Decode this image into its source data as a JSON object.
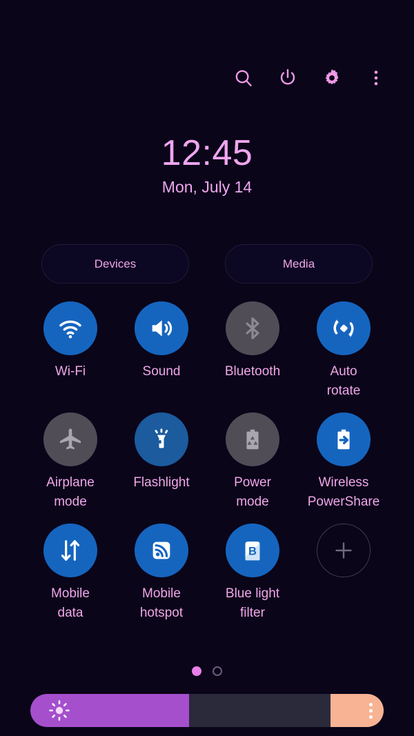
{
  "statusbar": {
    "actions": [
      {
        "name": "search-icon",
        "label": "Search"
      },
      {
        "name": "power-icon",
        "label": "Power off"
      },
      {
        "name": "settings-icon",
        "label": "Settings"
      },
      {
        "name": "more-options-icon",
        "label": "More options"
      }
    ],
    "icon_color": "#f09ae8"
  },
  "clock": {
    "time": "12:45",
    "date": "Mon, July 14",
    "color": "#f0a6f0"
  },
  "shortcuts": {
    "devices_label": "Devices",
    "media_label": "Media"
  },
  "tiles": [
    {
      "label": "Wi-Fi",
      "icon": "wifi-icon",
      "state": "on",
      "enabled": true
    },
    {
      "label": "Sound",
      "icon": "sound-icon",
      "state": "on",
      "enabled": true
    },
    {
      "label": "Bluetooth",
      "icon": "bluetooth-icon",
      "state": "off",
      "enabled": false
    },
    {
      "label": "Auto\nrotate",
      "icon": "auto-rotate-icon",
      "state": "on",
      "enabled": true
    },
    {
      "label": "Airplane\nmode",
      "icon": "airplane-icon",
      "state": "off",
      "enabled": false
    },
    {
      "label": "Flashlight",
      "icon": "flashlight-icon",
      "state": "on-dim",
      "enabled": true
    },
    {
      "label": "Power\nmode",
      "icon": "power-mode-icon",
      "state": "off",
      "enabled": false
    },
    {
      "label": "Wireless\nPowerShare",
      "icon": "power-share-icon",
      "state": "on",
      "enabled": true
    },
    {
      "label": "Mobile\ndata",
      "icon": "mobile-data-icon",
      "state": "on",
      "enabled": true
    },
    {
      "label": "Mobile\nhotspot",
      "icon": "mobile-hotspot-icon",
      "state": "on",
      "enabled": true
    },
    {
      "label": "Blue light\nfilter",
      "icon": "blue-light-filter-icon",
      "state": "on",
      "enabled": true
    },
    {
      "label": "",
      "icon": "add-icon",
      "state": "add",
      "enabled": false
    }
  ],
  "pager": {
    "pages": 2,
    "current_page": 1
  },
  "brightness": {
    "value_percent": 45,
    "icon": "brightness-sun-icon",
    "expand_icon": "more-options-icon",
    "fill_color": "#a54fcd",
    "track_color": "#2b2a3b",
    "expand_color": "#f7b394"
  },
  "theme": {
    "background": "#0a0519",
    "tile_on": "#1565bf",
    "tile_off": "#504d57",
    "label_color": "#f0a6ea"
  }
}
